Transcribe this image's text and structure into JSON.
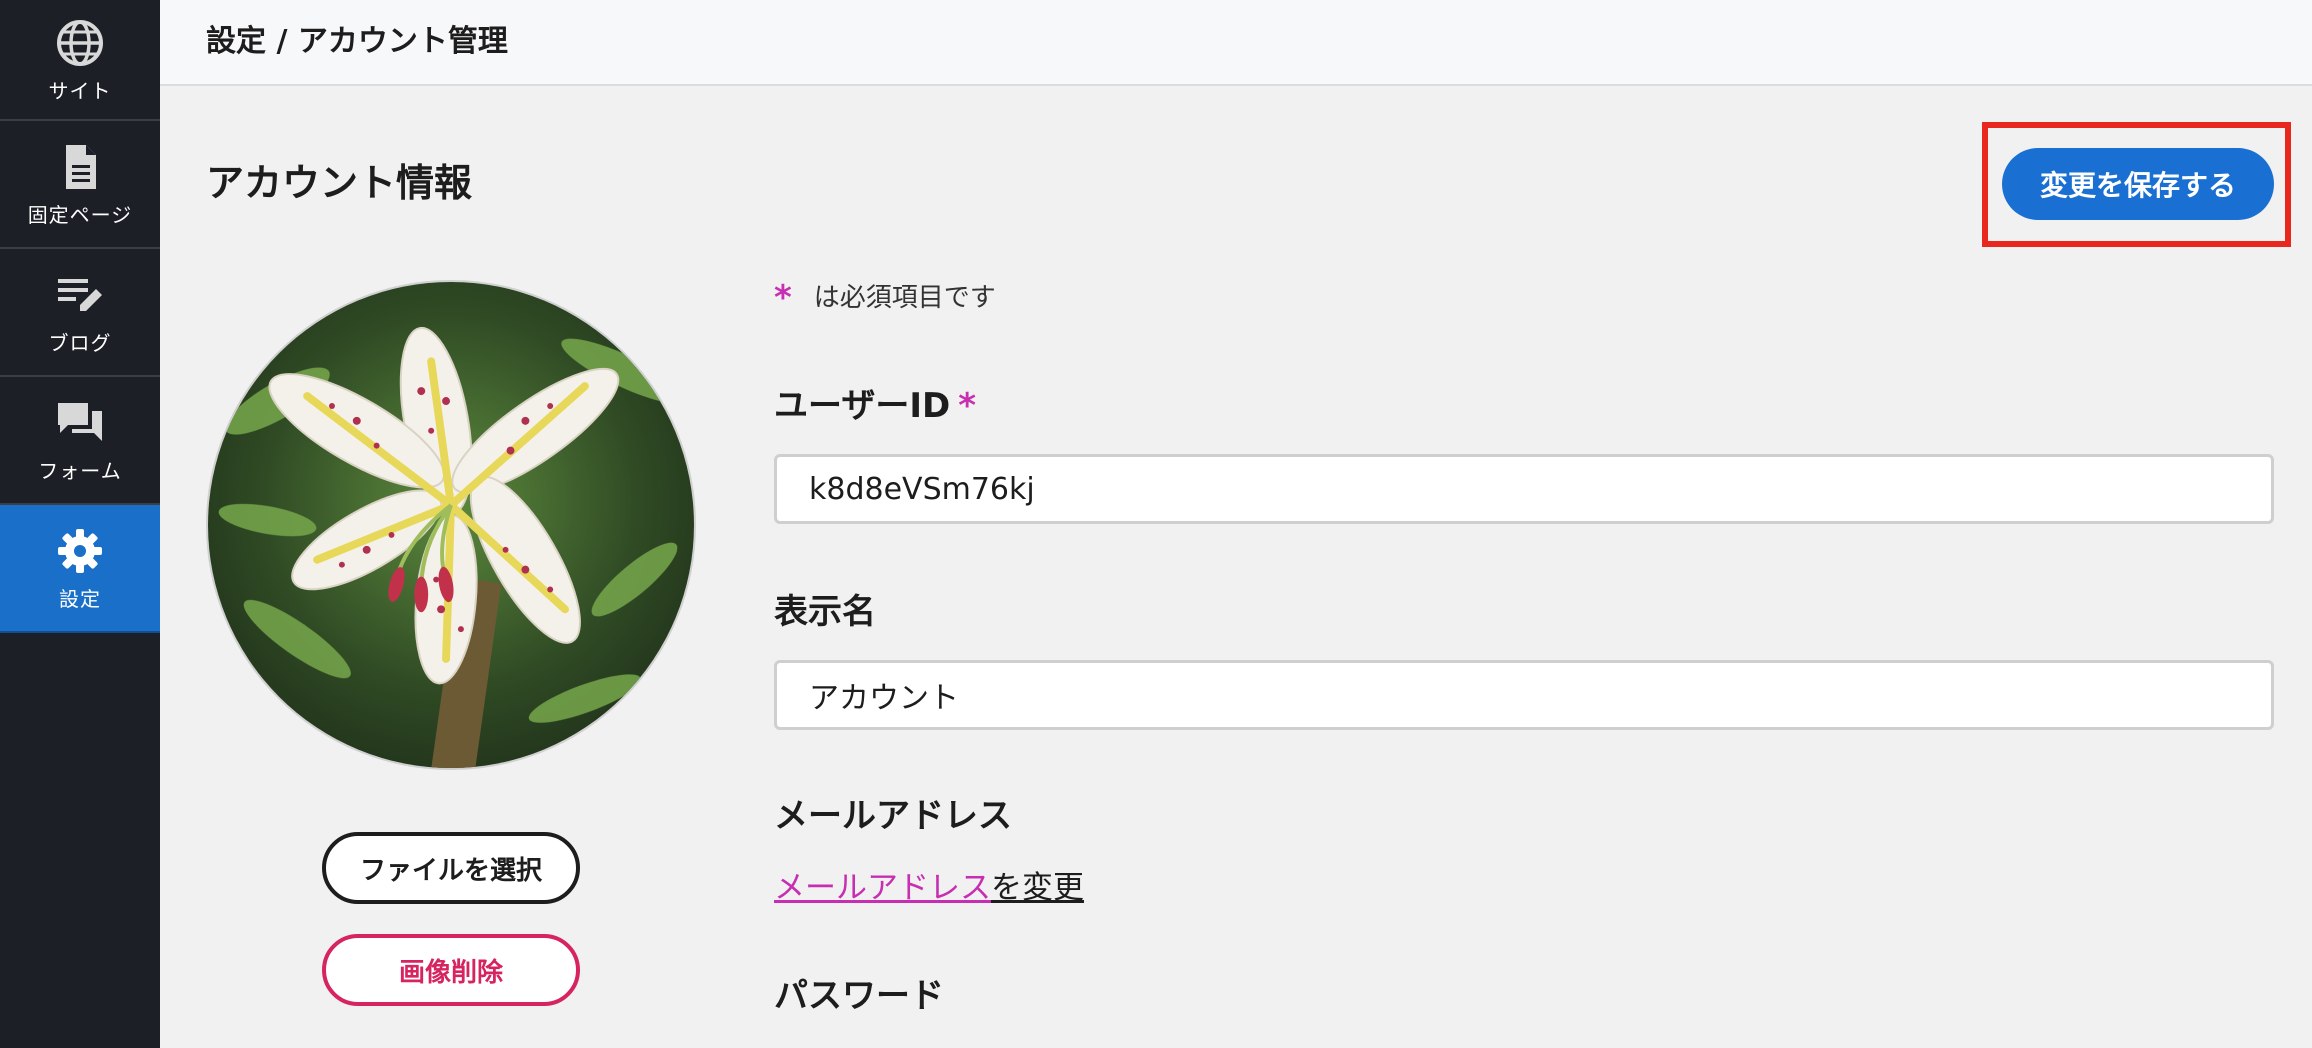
{
  "sidebar": {
    "items": [
      {
        "label": "サイト",
        "icon": "globe-icon"
      },
      {
        "label": "固定ページ",
        "icon": "document-icon"
      },
      {
        "label": "ブログ",
        "icon": "edit-list-icon"
      },
      {
        "label": "フォーム",
        "icon": "chat-icon"
      },
      {
        "label": "設定",
        "icon": "gear-icon",
        "active": true
      }
    ]
  },
  "header": {
    "breadcrumb": "設定 / アカウント管理"
  },
  "main": {
    "title": "アカウント情報",
    "save_label": "変更を保存する",
    "required_note": {
      "mark": "*",
      "text": "は必須項目です"
    },
    "avatar": {
      "file_button_label": "ファイルを選択",
      "delete_button_label": "画像削除"
    },
    "fields": {
      "user_id": {
        "label": "ユーザーID",
        "required_mark": "*",
        "value": "k8d8eVSm76kj"
      },
      "display_name": {
        "label": "表示名",
        "value": "アカウント"
      },
      "email": {
        "label": "メールアドレス",
        "link_text": "メールアドレス",
        "link_suffix": "を変更"
      },
      "password": {
        "label": "パスワード"
      }
    }
  },
  "colors": {
    "sidebar_bg": "#1c1f26",
    "active_nav": "#1a6fc9",
    "primary": "#1a6fd3",
    "required_mark": "#c72fb3",
    "danger": "#d6245f",
    "highlight_frame": "#e8281f"
  }
}
